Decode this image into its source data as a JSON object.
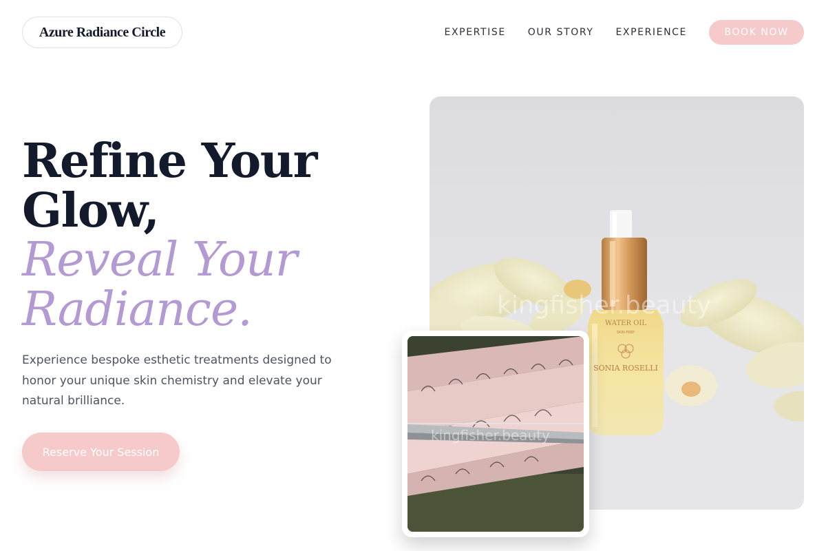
{
  "header": {
    "brand": "Azure Radiance Circle",
    "nav": [
      {
        "label": "EXPERTISE"
      },
      {
        "label": "OUR STORY"
      },
      {
        "label": "EXPERIENCE"
      }
    ],
    "cta_label": "BOOK NOW"
  },
  "hero": {
    "headline_line1": "Refine Your",
    "headline_line2": "Glow,",
    "headline_line3": "Reveal Your",
    "headline_line4": "Radiance.",
    "subcopy": "Experience bespoke esthetic treatments designed to honor your unique skin chemistry and elevate your natural brilliance.",
    "cta_label": "Reserve Your Session"
  },
  "images": {
    "main_watermark": "kingfisher.beauty",
    "inset_watermark": "kingfisher.beauty",
    "bottle_label_line1": "WATER OIL",
    "bottle_label_line2": "SKIN PREP",
    "bottle_brand": "SONIA ROSELLI"
  },
  "colors": {
    "accent_pink": "#f6c9ca",
    "accent_lavender": "#b39ad3",
    "headline_navy": "#131a2c"
  }
}
